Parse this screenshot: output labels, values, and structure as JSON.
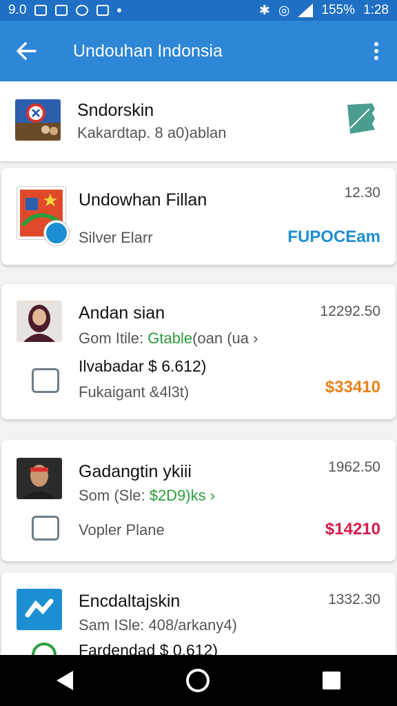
{
  "status_bar": {
    "left_time": "9.0",
    "battery": "155%",
    "time": "1:28"
  },
  "app_bar": {
    "title": "Undouhan Indonsia"
  },
  "top_item": {
    "title": "Sndorskin",
    "subtitle": "Kakardtap. 8 a0)ablan"
  },
  "cards": [
    {
      "title": "Undowhan Fillan",
      "amount": "12.30",
      "subtitle": "Silver Elarr",
      "tag": "FUPOCEam",
      "tag_color": "#1c8fd2"
    },
    {
      "title": "Andan sian",
      "amount": "12292.50",
      "line2_prefix": "Gom Itile: ",
      "line2_green": "Gtable",
      "line2_suffix": "(oan (ua ›",
      "line3": "Ilvabadar $ 6.612)",
      "line4": "Fukaigant &4l3t)",
      "price": "$33410",
      "price_color": "#e8821a"
    },
    {
      "title": "Gadangtin ykiii",
      "amount": "1962.50",
      "line2_prefix": "Som (Sle: ",
      "line2_green": "$2D9)ks ›",
      "line3": "Vopler Plane",
      "price": "$14210",
      "price_color": "#d81b4a"
    },
    {
      "title": "Encdaltajskin",
      "amount": "1332.30",
      "line2": "Sam ISle: 408/arkany4)",
      "line3": "Fardendad $ 0.612)"
    }
  ],
  "icons": [
    "back-arrow-icon",
    "more-vert-icon",
    "stamp-icon",
    "badge-icon",
    "wallet-icon",
    "calculator-icon",
    "nav-back-icon",
    "nav-home-icon",
    "nav-recents-icon"
  ]
}
